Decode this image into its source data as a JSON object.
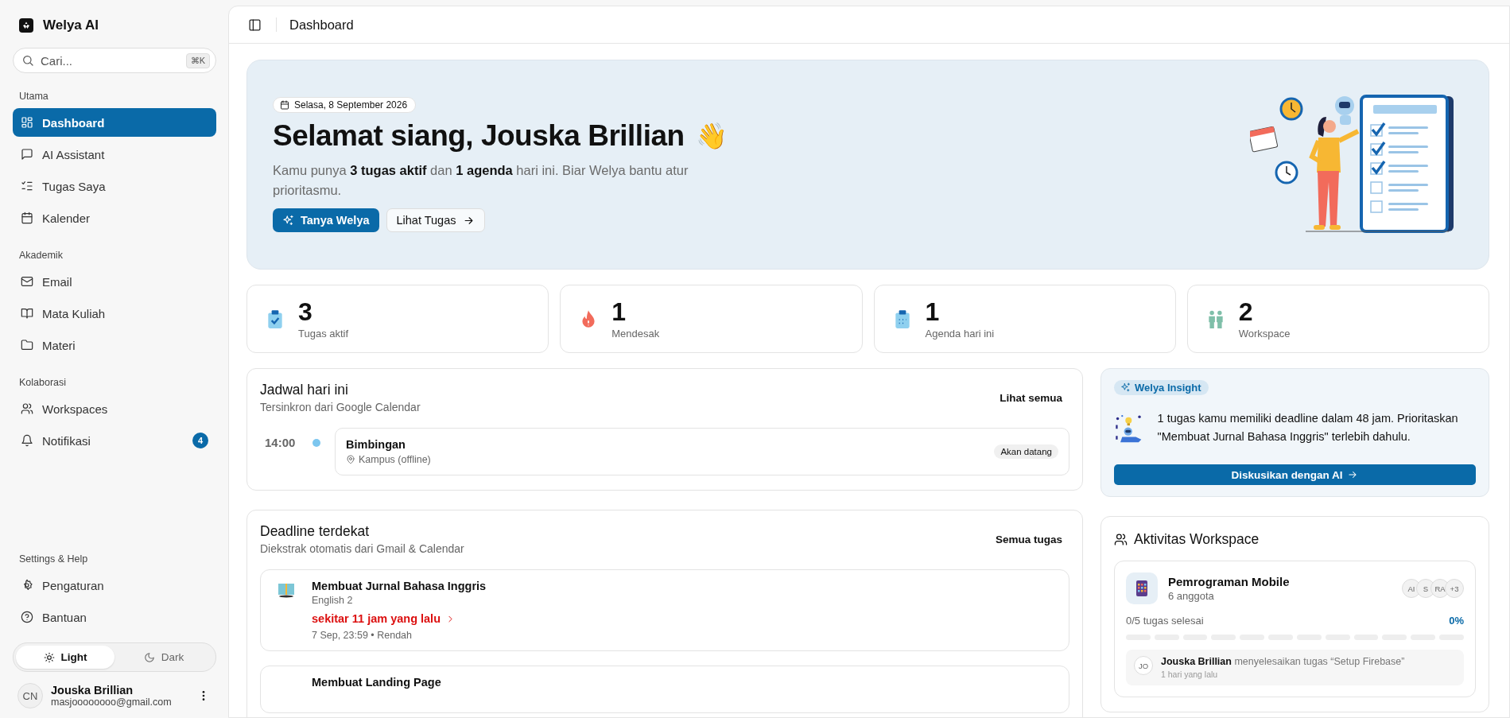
{
  "sidebar": {
    "brand": "Welya AI",
    "search": {
      "placeholder": "Cari...",
      "shortcut": "⌘K"
    },
    "sections": [
      {
        "title": "Utama",
        "items": [
          {
            "label": "Dashboard",
            "selected": true
          },
          {
            "label": "AI Assistant",
            "selected": false
          },
          {
            "label": "Tugas Saya",
            "selected": false
          },
          {
            "label": "Kalender",
            "selected": false
          }
        ]
      },
      {
        "title": "Akademik",
        "items": [
          {
            "label": "Email",
            "selected": false
          },
          {
            "label": "Mata Kuliah",
            "selected": false
          },
          {
            "label": "Materi",
            "selected": false
          }
        ]
      },
      {
        "title": "Kolaborasi",
        "items": [
          {
            "label": "Workspaces",
            "selected": false
          },
          {
            "label": "Notifikasi",
            "selected": false,
            "badge": "4"
          }
        ]
      }
    ],
    "help": {
      "title": "Settings & Help",
      "items": [
        {
          "label": "Pengaturan",
          "selected": false
        },
        {
          "label": "Bantuan",
          "selected": false
        }
      ]
    },
    "theme": [
      {
        "label": "Light",
        "selected": true
      },
      {
        "label": "Dark",
        "selected": false
      }
    ],
    "user": {
      "initials": "CN",
      "name": "Jouska Brillian",
      "email": "masjoooooooo@gmail.com"
    }
  },
  "header": {
    "title": "Dashboard"
  },
  "hero": {
    "date": "Selasa, 8 September 2026",
    "greeting": "Selamat siang, Jouska Brillian",
    "emoji": "👋",
    "text": "Kamu punya **3 tugas aktif** dan **1 agenda** hari ini. Biar Welya bantu atur prioritasmu.",
    "primary": "Tanya Welya",
    "secondary": "Lihat Tugas"
  },
  "stats": [
    {
      "value": "3",
      "label": "Tugas aktif"
    },
    {
      "value": "1",
      "label": "Mendesak"
    },
    {
      "value": "1",
      "label": "Agenda hari ini"
    },
    {
      "value": "2",
      "label": "Workspace"
    }
  ],
  "schedule": {
    "title": "Jadwal hari ini",
    "subtitle": "Tersinkron dari Google Calendar",
    "link": "Lihat semua",
    "events": [
      {
        "time": "14:00",
        "title": "Bimbingan",
        "location": "Kampus (offline)",
        "status": "Akan datang"
      }
    ]
  },
  "deadlines": {
    "title": "Deadline terdekat",
    "subtitle": "Diekstrak otomatis dari Gmail & Calendar",
    "link": "Semua tugas",
    "items": [
      {
        "title": "Membuat Jurnal Bahasa Inggris",
        "course": "English 2",
        "due": "sekitar 11 jam yang lalu",
        "overdue": true,
        "meta": "7 Sep, 23:59 • Rendah"
      },
      {
        "title": "Membuat Landing Page"
      }
    ]
  },
  "insight": {
    "badge": "Welya Insight",
    "text": "1 tugas kamu memiliki deadline dalam 48 jam. Prioritaskan \"Membuat Jurnal Bahasa Inggris\" terlebih dahulu.",
    "button": "Diskusikan dengan AI"
  },
  "activity": {
    "title": "Aktivitas Workspace",
    "workspace": {
      "name": "Pemrograman Mobile",
      "members": "6 anggota",
      "avatars": [
        "AI",
        "S",
        "RA",
        "+3"
      ],
      "progress_text": "0/5 tugas selesai",
      "percent": "0%",
      "events": [
        {
          "initials": "JO",
          "actor": "Jouska Brillian",
          "action": "menyelesaikan tugas “Setup Firebase”",
          "time": "1 hari yang lalu"
        }
      ]
    }
  }
}
